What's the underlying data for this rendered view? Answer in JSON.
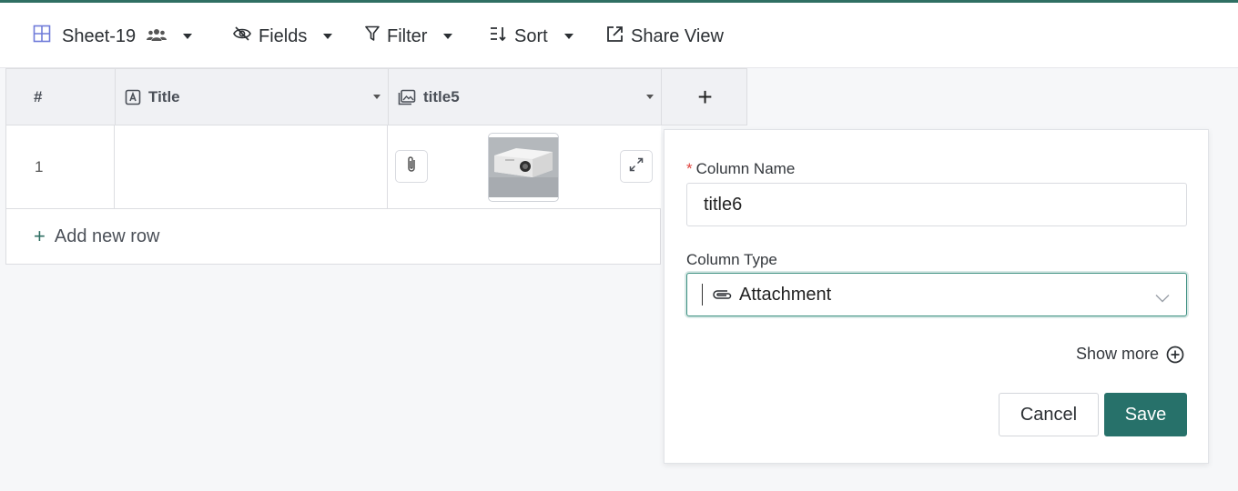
{
  "toolbar": {
    "sheet_name": "Sheet-19",
    "fields_label": "Fields",
    "filter_label": "Filter",
    "sort_label": "Sort",
    "share_label": "Share View"
  },
  "grid": {
    "columns": [
      {
        "label": "#"
      },
      {
        "label": "Title",
        "type_icon": "text-type-icon"
      },
      {
        "label": "title5",
        "type_icon": "image-type-icon"
      }
    ],
    "add_column_label": "+",
    "rows": [
      {
        "index": "1",
        "title": "",
        "attachment": "projector-image"
      }
    ],
    "add_row_label": "Add new row"
  },
  "panel": {
    "column_name_label": "Column Name",
    "required_marker": "*",
    "column_name_value": "title6",
    "column_type_label": "Column Type",
    "column_type_value": "Attachment",
    "show_more_label": "Show more",
    "cancel_label": "Cancel",
    "save_label": "Save"
  },
  "colors": {
    "accent": "#27716a",
    "required": "#e0443e",
    "focus_border": "#3c8f80"
  }
}
